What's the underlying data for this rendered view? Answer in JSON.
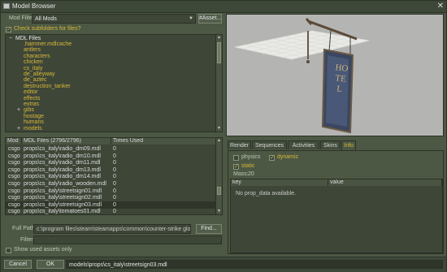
{
  "window": {
    "title": "Model Browser",
    "close": "✕"
  },
  "filter": {
    "label": "Mod Filter",
    "value": "All Mods",
    "asset_button": "#Asset...",
    "subfolders_label": "Check subfolders for files?",
    "subfolders_checked": true
  },
  "tree": {
    "root": "MDL Files",
    "items": [
      {
        "label": ".hammer.mdlcache",
        "expand": ""
      },
      {
        "label": "antlers",
        "expand": ""
      },
      {
        "label": "characters",
        "expand": ""
      },
      {
        "label": "chicken",
        "expand": ""
      },
      {
        "label": "cs_italy",
        "expand": ""
      },
      {
        "label": "de_alleyway",
        "expand": ""
      },
      {
        "label": "de_aztec",
        "expand": ""
      },
      {
        "label": "destruction_tanker",
        "expand": ""
      },
      {
        "label": "editor",
        "expand": ""
      },
      {
        "label": "effects",
        "expand": ""
      },
      {
        "label": "extras",
        "expand": ""
      },
      {
        "label": "gibs",
        "expand": "+"
      },
      {
        "label": "hostage",
        "expand": ""
      },
      {
        "label": "humans",
        "expand": ""
      },
      {
        "label": "models",
        "expand": "+"
      }
    ]
  },
  "files": {
    "headers": {
      "mod": "Mod",
      "file": "MDL Files (2796/2796)",
      "times": "Times Used"
    },
    "rows": [
      {
        "mod": "csgo",
        "file": "props\\cs_italy\\radio_dm09.mdl",
        "times": "0"
      },
      {
        "mod": "csgo",
        "file": "props\\cs_italy\\radio_dm10.mdl",
        "times": "0"
      },
      {
        "mod": "csgo",
        "file": "props\\cs_italy\\radio_dm11.mdl",
        "times": "0"
      },
      {
        "mod": "csgo",
        "file": "props\\cs_italy\\radio_dm13.mdl",
        "times": "0"
      },
      {
        "mod": "csgo",
        "file": "props\\cs_italy\\radio_dm14.mdl",
        "times": "0"
      },
      {
        "mod": "csgo",
        "file": "props\\cs_italy\\radio_wooden.mdl",
        "times": "0"
      },
      {
        "mod": "csgo",
        "file": "props\\cs_italy\\streetsign01.mdl",
        "times": "0"
      },
      {
        "mod": "csgo",
        "file": "props\\cs_italy\\streetsign02.mdl",
        "times": "0"
      },
      {
        "mod": "csgo",
        "file": "props\\cs_italy\\streetsign03.mdl",
        "times": "0"
      },
      {
        "mod": "csgo",
        "file": "props\\cs_italy\\tomatoes01.mdl",
        "times": "0"
      }
    ],
    "selected_index": 8
  },
  "fullpath": {
    "label": "Full Path",
    "value": "c:\\program files\\steam\\steamapps\\common\\counter-strike global offensive",
    "find_button": "Find..."
  },
  "search": {
    "label": "Filter",
    "value": ""
  },
  "show_used": {
    "label": "Show used assets only",
    "checked": false
  },
  "preview": {
    "sign_text": "HOTEL"
  },
  "tabs": [
    "Render",
    "Sequences",
    "Activities",
    "Skins",
    "Info"
  ],
  "active_tab": "Info",
  "info": {
    "physics_label": "physics",
    "physics_checked": false,
    "dynamic_label": "dynamic",
    "dynamic_checked": true,
    "static_label": "static",
    "static_checked": true,
    "mass_label": "Mass:",
    "mass_value": "20",
    "col_key": "key",
    "col_value": "value",
    "empty_text": "No prop_data available."
  },
  "bottom": {
    "cancel": "Cancel",
    "ok": "OK",
    "selected_path": "models\\props\\cs_italy\\streetsign03.mdl"
  }
}
